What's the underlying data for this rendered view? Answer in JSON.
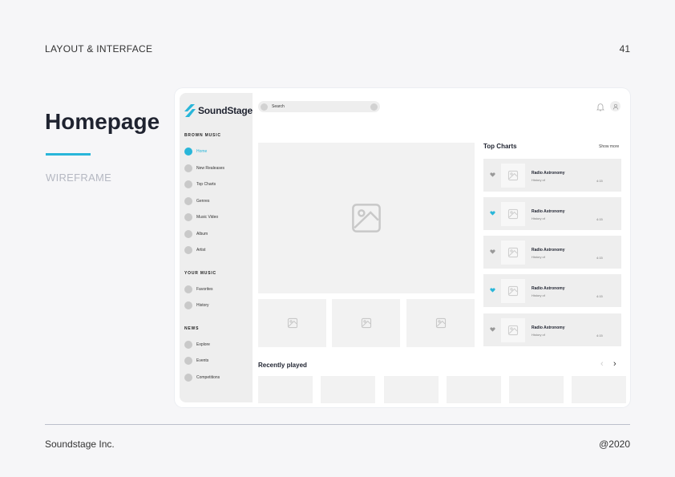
{
  "page": {
    "header": "LAYOUT & INTERFACE",
    "number": "41",
    "title": "Homepage",
    "subtitle": "WIREFRAME",
    "footer_left": "Soundstage Inc.",
    "footer_right": "@2020"
  },
  "app": {
    "logo_text": "SoundStage",
    "search_placeholder": "Search",
    "accent": "#29b6d9",
    "sidebar": {
      "browse_title": "BROWN MUSIC",
      "browse_items": [
        "Home",
        "New Realeases",
        "Top Charts",
        "Genres",
        "Music Video",
        "Album",
        "Artist"
      ],
      "your_music_title": "YOUR MUSIC",
      "your_music_items": [
        "Favorites",
        "History"
      ],
      "news_title": "NEWS",
      "news_items": [
        "Explore",
        "Events",
        "Competitions"
      ]
    },
    "top_charts": {
      "title": "Top Charts",
      "show_more": "Show more",
      "items": [
        {
          "title": "Radio Astronomy",
          "subtitle": "History of",
          "duration": "4:15",
          "favorited": false
        },
        {
          "title": "Radio Astronomy",
          "subtitle": "History of",
          "duration": "4:15",
          "favorited": true
        },
        {
          "title": "Radio Astronomy",
          "subtitle": "History of",
          "duration": "4:15",
          "favorited": false
        },
        {
          "title": "Radio Astronomy",
          "subtitle": "History of",
          "duration": "4:15",
          "favorited": true
        },
        {
          "title": "Radio Astronomy",
          "subtitle": "History of",
          "duration": "4:15",
          "favorited": false
        }
      ]
    },
    "recently_played": {
      "title": "Recently played",
      "prev_icon": "chevron-left-icon",
      "next_icon": "chevron-right-icon"
    }
  }
}
